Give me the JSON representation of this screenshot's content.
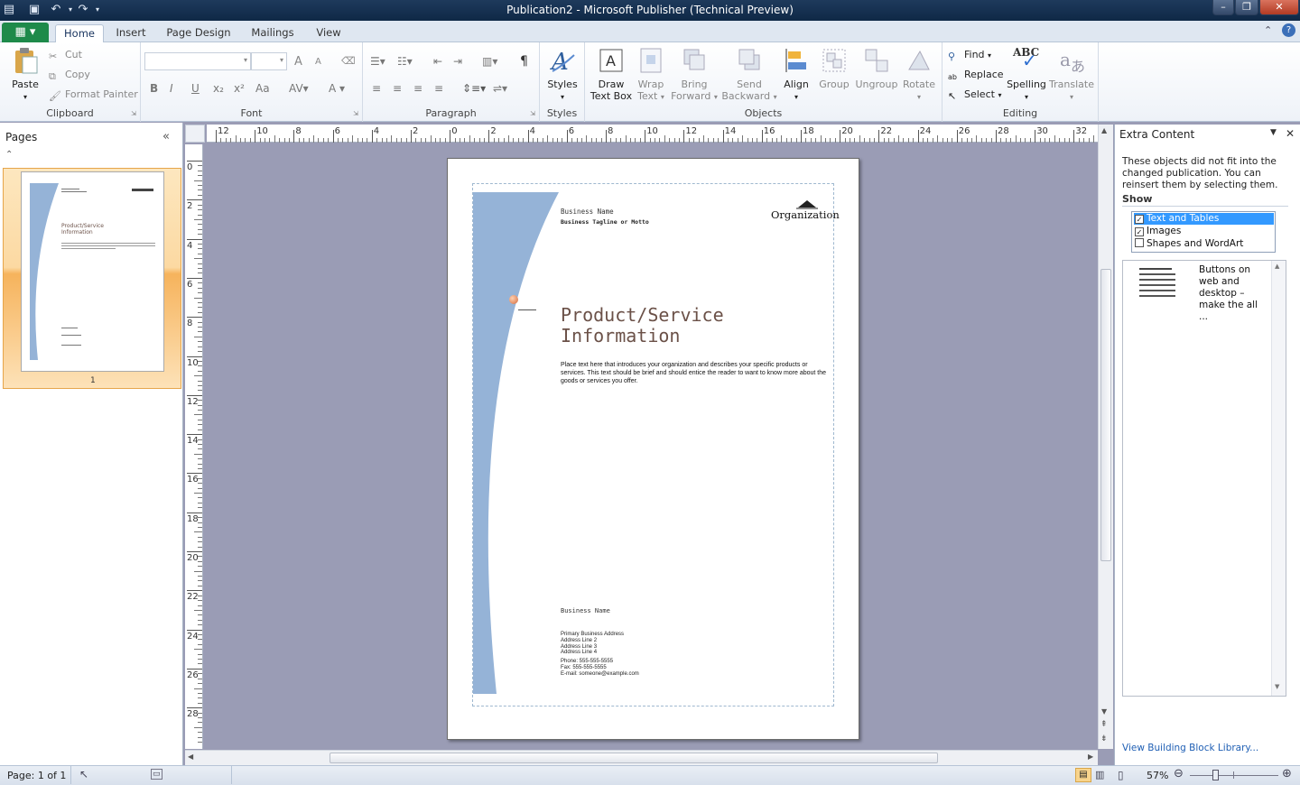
{
  "window": {
    "title": "Publication2  -  Microsoft Publisher (Technical Preview)"
  },
  "tabs": [
    "Home",
    "Insert",
    "Page Design",
    "Mailings",
    "View"
  ],
  "ribbon": {
    "clipboard": {
      "label": "Clipboard",
      "paste": "Paste",
      "cut": "Cut",
      "copy": "Copy",
      "format_painter": "Format Painter"
    },
    "font": {
      "label": "Font",
      "bold": "B",
      "italic": "I",
      "underline": "U",
      "subscript": "x₂",
      "superscript": "x²",
      "change_case": "Aa",
      "grow": "A",
      "shrink": "A"
    },
    "paragraph": {
      "label": "Paragraph",
      "pilcrow": "¶"
    },
    "styles": {
      "label": "Styles",
      "button": "Styles"
    },
    "objects": {
      "label": "Objects",
      "draw_text_box": [
        "Draw",
        "Text Box"
      ],
      "wrap_text": [
        "Wrap",
        "Text"
      ],
      "bring_forward": [
        "Bring",
        "Forward"
      ],
      "send_backward": [
        "Send",
        "Backward"
      ],
      "align": "Align",
      "group": "Group",
      "ungroup": "Ungroup",
      "rotate": "Rotate"
    },
    "editing": {
      "label": "Editing",
      "find": "Find",
      "replace": "Replace",
      "select": "Select",
      "spelling": "Spelling",
      "translate": "Translate",
      "abc": "ABC"
    }
  },
  "pages_pane": {
    "title": "Pages",
    "page_number": "1"
  },
  "ruler": {
    "horizontal": [
      "12",
      "10",
      "8",
      "6",
      "4",
      "2",
      "0",
      "2",
      "4",
      "6",
      "8",
      "10",
      "12",
      "14",
      "16",
      "18",
      "20",
      "22",
      "24",
      "26",
      "28",
      "30",
      "32"
    ],
    "vertical": [
      "0",
      "2",
      "4",
      "6",
      "8",
      "10",
      "12",
      "14",
      "16",
      "18",
      "20",
      "22",
      "24",
      "26",
      "28"
    ]
  },
  "document": {
    "business_name": "Business Name",
    "tagline": "Business Tagline or Motto",
    "organization": "Organization",
    "heading_line1": "Product/Service",
    "heading_line2": "Information",
    "body": "Place text here that introduces your organization and describes your specific products or services. This text should be brief and should entice the reader to want to know more about the goods or services you offer.",
    "footer_business_name": "Business Name",
    "address": [
      "Primary Business Address",
      "Address Line 2",
      "Address Line 3",
      "Address Line 4"
    ],
    "contact": [
      "Phone: 555-555-5555",
      "Fax: 555-555-5555",
      "E-mail: someone@example.com"
    ]
  },
  "task_pane": {
    "title": "Extra Content",
    "description": "These objects did not fit into the changed publication. You can reinsert them by selecting them.",
    "show_label": "Show",
    "filters": [
      {
        "label": "Text and Tables",
        "checked": true
      },
      {
        "label": "Images",
        "checked": true
      },
      {
        "label": "Shapes and WordArt",
        "checked": false
      }
    ],
    "item_text": "Buttons on web and desktop – make the all ...",
    "library_link": "View Building Block Library..."
  },
  "status": {
    "page": "Page: 1 of 1",
    "zoom": "57%"
  },
  "colors": {
    "accent_curve": "#95b3d7",
    "heading": "#6b5148",
    "file_tab": "#1e8a4a",
    "titlebar": "#1e3a5c"
  }
}
